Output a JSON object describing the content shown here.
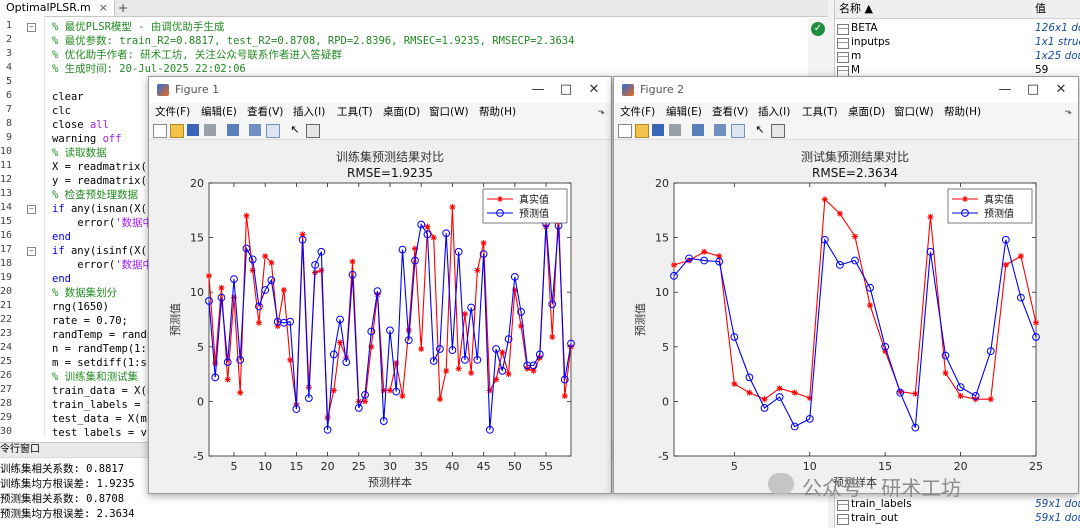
{
  "editor": {
    "tab_label": "OptimalPLSR.m",
    "tab_close": "×",
    "tab_plus": "+",
    "lines": [
      {
        "n": "1",
        "text": "% 最优PLSR模型 - 由调优助手生成",
        "cls": "cmt"
      },
      {
        "n": "2",
        "text": "% 最优参数: train_R2=0.8817, test_R2=0.8708, RPD=2.8396, RMSEC=1.9235, RMSECP=2.3634",
        "cls": "cmt"
      },
      {
        "n": "3",
        "text": "% 优化助手作者: 研术工坊, 关注公众号联系作者进入答疑群",
        "cls": "cmt"
      },
      {
        "n": "4",
        "text": "% 生成时间: 20-Jul-2025 22:02:06",
        "cls": "cmt"
      },
      {
        "n": "5",
        "text": "",
        "cls": ""
      },
      {
        "n": "6",
        "text": "clear",
        "cls": ""
      },
      {
        "n": "7",
        "text": "clc",
        "cls": ""
      },
      {
        "n": "8",
        "text": "close all",
        "cls": "mixed-all"
      },
      {
        "n": "9",
        "text": "warning off",
        "cls": "mixed-off"
      },
      {
        "n": "10",
        "text": "% 读取数据",
        "cls": "cmt"
      },
      {
        "n": "11",
        "text": "X = readmatrix('",
        "cls": "mixed-str"
      },
      {
        "n": "12",
        "text": "y = readmatrix('",
        "cls": "mixed-str"
      },
      {
        "n": "13",
        "text": "% 检查预处理数据",
        "cls": "cmt"
      },
      {
        "n": "14",
        "text": "if any(isnan(X(:",
        "cls": "mixed-if"
      },
      {
        "n": "15",
        "text": "    error('数据中",
        "cls": "mixed-err"
      },
      {
        "n": "16",
        "text": "end",
        "cls": "kw"
      },
      {
        "n": "17",
        "text": "if any(isinf(X(:",
        "cls": "mixed-if"
      },
      {
        "n": "18",
        "text": "    error('数据中",
        "cls": "mixed-err"
      },
      {
        "n": "19",
        "text": "end",
        "cls": "kw"
      },
      {
        "n": "20",
        "text": "% 数据集划分",
        "cls": "cmt"
      },
      {
        "n": "21",
        "text": "rng(1650)",
        "cls": ""
      },
      {
        "n": "22",
        "text": "rate = 0.70;",
        "cls": ""
      },
      {
        "n": "23",
        "text": "randTemp = randp",
        "cls": ""
      },
      {
        "n": "24",
        "text": "n = randTemp(1:c",
        "cls": ""
      },
      {
        "n": "25",
        "text": "m = setdiff(1:si",
        "cls": ""
      },
      {
        "n": "26",
        "text": "% 训练集和测试集",
        "cls": "cmt"
      },
      {
        "n": "27",
        "text": "train_data = X(n",
        "cls": ""
      },
      {
        "n": "28",
        "text": "train_labels = y",
        "cls": ""
      },
      {
        "n": "29",
        "text": "test_data = X(m,",
        "cls": ""
      },
      {
        "n": "30",
        "text": "test_labels = y(",
        "cls": ""
      }
    ]
  },
  "command_window": {
    "title": "令行窗口",
    "outputs": [
      "训练集相关系数: 0.8817",
      "训练集均方根误差: 1.9235",
      "预测集相关系数: 0.8708",
      "预测集均方根误差: 2.3634"
    ]
  },
  "workspace": {
    "col_name": "名称 ▲",
    "col_value": "值",
    "rows": [
      {
        "name": "BETA",
        "value": "126x1 dou",
        "plain": false
      },
      {
        "name": "inputps",
        "value": "1x1 struc",
        "plain": false
      },
      {
        "name": "m",
        "value": "1x25 dou",
        "plain": false
      },
      {
        "name": "M",
        "value": "59",
        "plain": true
      }
    ],
    "bottom_rows": [
      {
        "name": "train_labels",
        "value": "59x1 dou",
        "plain": false
      },
      {
        "name": "train_out",
        "value": "59x1 dou",
        "plain": false
      }
    ]
  },
  "watermark": "公众号 · 研术工坊",
  "figures": [
    {
      "title": "Figure 1",
      "menus": [
        "文件(F)",
        "编辑(E)",
        "查看(V)",
        "插入(I)",
        "工具(T)",
        "桌面(D)",
        "窗口(W)",
        "帮助(H)"
      ],
      "controls": {
        "min": "—",
        "max": "□",
        "close": "✕"
      }
    },
    {
      "title": "Figure 2",
      "menus": [
        "文件(F)",
        "编辑(E)",
        "查看(V)",
        "插入(I)",
        "工具(T)",
        "桌面(D)",
        "窗口(W)",
        "帮助(H)"
      ],
      "controls": {
        "min": "—",
        "max": "□",
        "close": "✕"
      }
    }
  ],
  "chart_data": [
    {
      "type": "line",
      "title": "训练集预测结果对比",
      "subtitle": "RMSE=1.9235",
      "xlabel": "预测样本",
      "ylabel": "预测值",
      "xlim": [
        1,
        59
      ],
      "ylim": [
        -5,
        20
      ],
      "xticks": [
        5,
        10,
        15,
        20,
        25,
        30,
        35,
        40,
        45,
        50,
        55
      ],
      "yticks": [
        -5,
        0,
        5,
        10,
        15,
        20
      ],
      "legend_position": "top-right",
      "grid": false,
      "series": [
        {
          "name": "真实值",
          "color": "#ff0000",
          "marker": "asterisk",
          "values": [
            11.5,
            3.5,
            10.4,
            2.0,
            9.5,
            0.8,
            17.0,
            12.0,
            7.2,
            13.3,
            12.7,
            6.9,
            10.2,
            3.8,
            -0.3,
            15.3,
            1.3,
            11.8,
            12.0,
            -1.5,
            1.0,
            5.4,
            4.0,
            12.8,
            0.0,
            0.0,
            5.0,
            9.8,
            1.0,
            1.0,
            3.5,
            0.5,
            6.5,
            14.0,
            4.8,
            16.0,
            15.0,
            0.2,
            2.8,
            17.8,
            3.0,
            8.0,
            2.6,
            12.0,
            14.5,
            1.0,
            2.0,
            4.5,
            2.5,
            10.2,
            6.9,
            3.0,
            2.8,
            4.0,
            16.0,
            5.9,
            17.5,
            0.5,
            5.0
          ]
        },
        {
          "name": "预测值",
          "color": "#0000ff",
          "marker": "circle",
          "values": [
            9.2,
            2.2,
            9.5,
            3.6,
            11.2,
            3.8,
            14.0,
            13.0,
            8.7,
            10.2,
            11.1,
            7.3,
            7.2,
            7.3,
            -0.7,
            14.8,
            0.3,
            12.5,
            13.7,
            -2.6,
            4.3,
            7.5,
            3.6,
            11.6,
            -0.6,
            0.6,
            6.4,
            10.1,
            -1.8,
            6.5,
            0.9,
            13.9,
            5.6,
            12.9,
            16.2,
            15.3,
            3.7,
            4.8,
            15.4,
            4.7,
            13.7,
            3.8,
            8.6,
            3.8,
            13.5,
            -2.6,
            4.8,
            2.8,
            5.7,
            11.4,
            8.2,
            3.3,
            3.3,
            4.3,
            16.3,
            8.9,
            16.1,
            2.0,
            5.3
          ]
        }
      ]
    },
    {
      "type": "line",
      "title": "测试集预测结果对比",
      "subtitle": "RMSE=2.3634",
      "xlabel": "预测样本",
      "ylabel": "预测值",
      "xlim": [
        1,
        25
      ],
      "ylim": [
        -5,
        20
      ],
      "xticks": [
        5,
        10,
        15,
        20,
        25
      ],
      "yticks": [
        -5,
        0,
        5,
        10,
        15,
        20
      ],
      "legend_position": "top-right",
      "grid": false,
      "series": [
        {
          "name": "真实值",
          "color": "#ff0000",
          "marker": "asterisk",
          "values": [
            12.5,
            12.9,
            13.7,
            13.3,
            1.6,
            0.8,
            0.2,
            1.2,
            0.8,
            0.3,
            18.5,
            17.2,
            15.1,
            8.8,
            4.6,
            0.9,
            0.7,
            16.9,
            2.6,
            0.5,
            0.2,
            0.2,
            12.5,
            13.3,
            7.2
          ]
        },
        {
          "name": "预测值",
          "color": "#0000ff",
          "marker": "circle",
          "values": [
            11.5,
            13.1,
            12.9,
            12.8,
            5.9,
            2.2,
            -0.6,
            0.4,
            -2.3,
            -1.6,
            14.8,
            12.5,
            12.9,
            10.4,
            5.0,
            0.8,
            -2.4,
            13.7,
            4.2,
            1.3,
            0.5,
            4.6,
            14.8,
            9.5,
            5.9
          ]
        }
      ]
    }
  ]
}
